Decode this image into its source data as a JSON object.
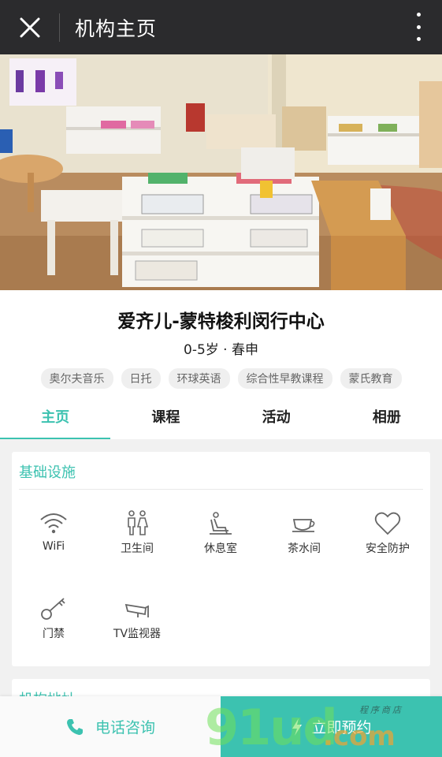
{
  "header": {
    "title": "机构主页",
    "close_icon": "close-icon",
    "more_icon": "more-vertical-icon"
  },
  "org": {
    "name": "爱齐儿-蒙特梭利闵行中心",
    "meta": "0-5岁 · 春申",
    "tags": [
      "奥尔夫音乐",
      "日托",
      "环球英语",
      "综合性早教课程",
      "蒙氏教育"
    ]
  },
  "tabs": [
    {
      "label": "主页",
      "active": true
    },
    {
      "label": "课程",
      "active": false
    },
    {
      "label": "活动",
      "active": false
    },
    {
      "label": "相册",
      "active": false
    }
  ],
  "facilities": {
    "title": "基础设施",
    "items": [
      {
        "label": "WiFi",
        "icon": "wifi-icon"
      },
      {
        "label": "卫生间",
        "icon": "restroom-icon"
      },
      {
        "label": "休息室",
        "icon": "lounge-chair-icon"
      },
      {
        "label": "茶水间",
        "icon": "tea-cup-icon"
      },
      {
        "label": "安全防护",
        "icon": "heart-icon"
      },
      {
        "label": "门禁",
        "icon": "key-icon"
      },
      {
        "label": "TV监视器",
        "icon": "camera-icon"
      }
    ]
  },
  "address": {
    "title": "机构地址"
  },
  "actions": {
    "call_label": "电话咨询",
    "book_label": "立即预约"
  },
  "watermark": {
    "main": "91ud",
    "suffix": ".com",
    "small": "程序商店"
  },
  "colors": {
    "accent": "#3cc2b0",
    "topbar": "#2b2b2d"
  }
}
